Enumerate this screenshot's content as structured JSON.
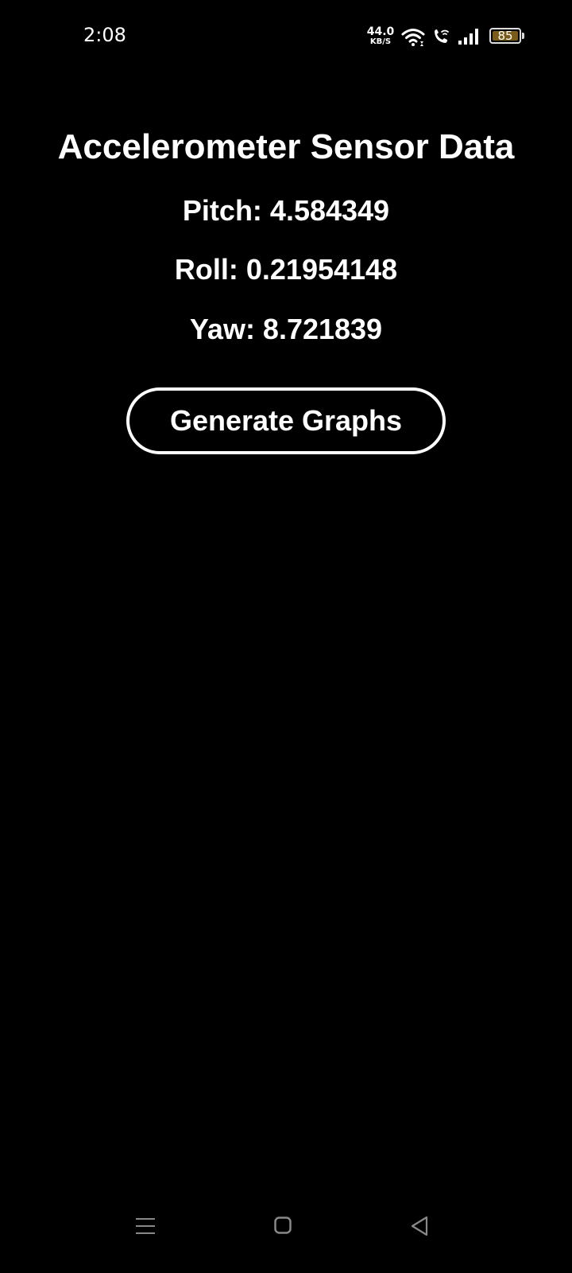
{
  "status_bar": {
    "time": "2:08",
    "net_speed_value": "44.0",
    "net_speed_unit": "KB/S",
    "battery_level": "85",
    "icons": [
      "wifi-icon",
      "call-icon",
      "signal-icon",
      "battery-icon"
    ]
  },
  "main": {
    "title": "Accelerometer Sensor Data",
    "pitch": "Pitch: 4.584349",
    "roll": "Roll: 0.21954148",
    "yaw": "Yaw: 8.721839",
    "generate_button_label": "Generate Graphs"
  },
  "nav_bar": {
    "icons": [
      "recents-menu-icon",
      "home-icon",
      "back-icon"
    ]
  },
  "colors": {
    "background": "#000000",
    "text": "#ffffff",
    "battery_fill": "#7a5c18"
  }
}
